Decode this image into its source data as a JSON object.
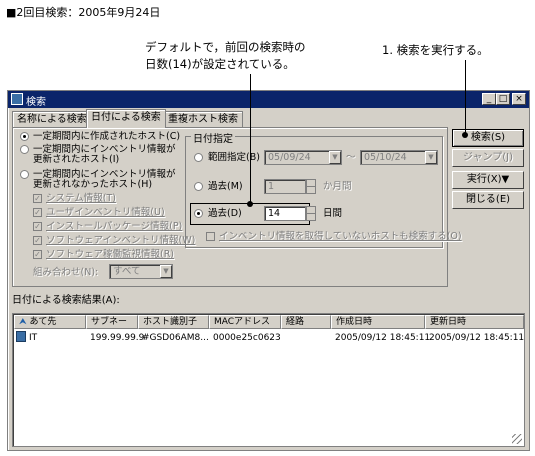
{
  "heading": "■2回目検索：2005年9月24日",
  "callouts": {
    "default_note_line1": "デフォルトで，前回の検索時の",
    "default_note_line2": "日数(14)が設定されている。",
    "run_note": "1. 検索を実行する。"
  },
  "window": {
    "title": "検索",
    "controls": [
      "_",
      "□",
      "×"
    ]
  },
  "tabs": [
    {
      "label": "名称による検索",
      "active": false
    },
    {
      "label": "日付による検索",
      "active": true
    },
    {
      "label": "重複ホスト検索",
      "active": false
    }
  ],
  "host_criteria": {
    "opt_created": "一定期間内に作成されたホスト(C)",
    "opt_updated_line1": "一定期間内にインベントリ情報が",
    "opt_updated_line2": "更新されたホスト(I)",
    "opt_not_updated_line1": "一定期間内にインベントリ情報が",
    "opt_not_updated_line2": "更新されなかったホスト(H)",
    "checks": [
      "システム情報(T)",
      "ユーザインベントリ情報(U)",
      "インストールパッケージ情報(P)",
      "ソフトウェアインベントリ情報(W)",
      "ソフトウェア稼働監視情報(R)"
    ],
    "combination_label": "組み合わせ(N):",
    "combination_value": "すべて"
  },
  "date_spec": {
    "group_title": "日付指定",
    "range_label": "範囲指定(B)",
    "range_from": "05/09/24",
    "range_sep": "～",
    "range_to": "05/10/24",
    "months_label": "過去(M)",
    "months_value": "1",
    "months_unit": "か月間",
    "days_label": "過去(D)",
    "days_value": "14",
    "days_unit": "日間",
    "include_missing_label": "インベントリ情報を取得していないホストも検索する(O)"
  },
  "buttons": {
    "search": "検索(S)",
    "jump": "ジャンプ(J)",
    "execute": "実行(X)▼",
    "close": "閉じる(E)"
  },
  "results": {
    "label": "日付による検索結果(A):",
    "columns": [
      "あて先",
      "サブネー",
      "ホスト識別子",
      "MACアドレス",
      "経路",
      "作成日時",
      "更新日時"
    ],
    "rows": [
      [
        "IT",
        "199.99.99.9",
        "#GSD06AM8...",
        "0000e25c0623",
        "",
        "2005/09/12 18:45:11",
        "2005/09/12 18:45:11"
      ]
    ]
  }
}
